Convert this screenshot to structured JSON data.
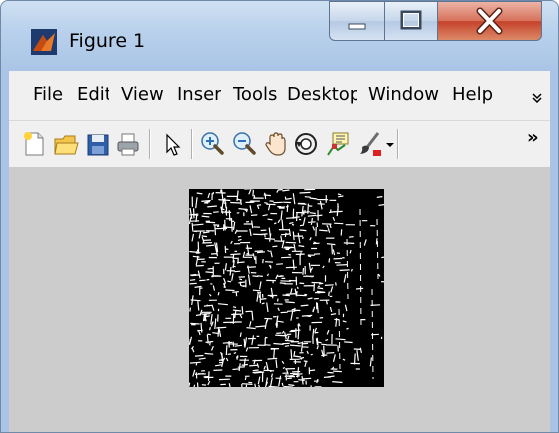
{
  "window": {
    "title": "Figure 1"
  },
  "menu": {
    "items": [
      "File",
      "Edit",
      "View",
      "Insert",
      "Tools",
      "Desktop",
      "Window",
      "Help"
    ],
    "overflow_arrow": "»"
  },
  "toolbar": {
    "icons": [
      "new-figure-icon",
      "open-file-icon",
      "save-figure-icon",
      "print-figure-icon",
      "edit-plot-arrow-icon",
      "zoom-in-icon",
      "zoom-out-icon",
      "pan-hand-icon",
      "rotate-3d-icon",
      "data-cursor-icon",
      "brush-icon",
      "dropdown-arrow-icon"
    ],
    "overflow": "»"
  },
  "colors": {
    "titlebar": "#b9d1ec",
    "close": "#c5412a",
    "canvas": "#cccccc",
    "image_bg": "#000000",
    "edges": "#ffffff"
  }
}
